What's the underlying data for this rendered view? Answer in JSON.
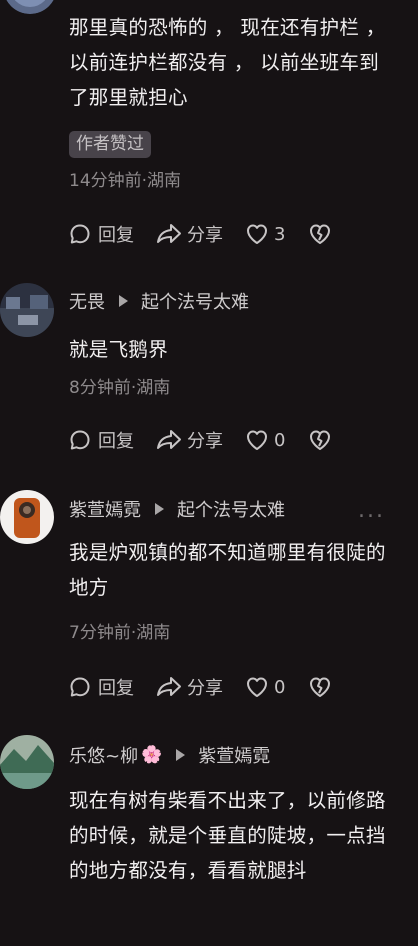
{
  "comments": [
    {
      "text": "那里真的恐怖的 ， 现在还有护栏 ， 以前连护栏都没有 ， 以前坐班车到了那里就担心",
      "badge": "作者赞过",
      "meta": "14分钟前·湖南",
      "reply": "回复",
      "share": "分享",
      "likes": "3"
    },
    {
      "author": "无畏",
      "reply_to": "起个法号太难",
      "text": "就是飞鹅界",
      "meta": "8分钟前·湖南",
      "reply": "回复",
      "share": "分享",
      "likes": "0"
    },
    {
      "author": "紫萱嫣霓",
      "reply_to": "起个法号太难",
      "text": "我是炉观镇的都不知道哪里有很陡的地方",
      "meta": "7分钟前·湖南",
      "reply": "回复",
      "share": "分享",
      "likes": "0",
      "more": "..."
    },
    {
      "author": "乐悠~柳",
      "author_emoji": "🌸",
      "reply_to": "紫萱嫣霓",
      "text": "现在有树有柴看不出来了，以前修路的时候，就是个垂直的陡坡，一点挡的地方都没有，看看就腿抖"
    }
  ],
  "colors": {
    "background": "#161214",
    "badge_bg": "#48434a"
  }
}
